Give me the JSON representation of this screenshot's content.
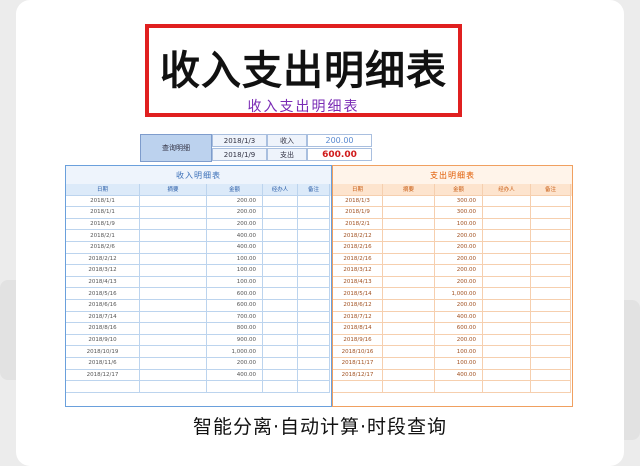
{
  "header": {
    "big_title": "收入支出明细表",
    "sub_title": "收入支出明细表"
  },
  "query": {
    "label": "查询明细",
    "date_start": "2018/1/3",
    "date_end": "2018/1/9",
    "income_label": "收入",
    "income_value": "200.00",
    "expense_label": "支出",
    "expense_value": "600.00"
  },
  "income_table": {
    "title": "收入明细表",
    "headers": [
      "日期",
      "摘要",
      "金额",
      "经办人",
      "备注"
    ],
    "rows": [
      [
        "2018/1/1",
        "",
        "200.00",
        "",
        ""
      ],
      [
        "2018/1/1",
        "",
        "200.00",
        "",
        ""
      ],
      [
        "2018/1/9",
        "",
        "200.00",
        "",
        ""
      ],
      [
        "2018/2/1",
        "",
        "400.00",
        "",
        ""
      ],
      [
        "2018/2/6",
        "",
        "400.00",
        "",
        ""
      ],
      [
        "2018/2/12",
        "",
        "100.00",
        "",
        ""
      ],
      [
        "2018/3/12",
        "",
        "100.00",
        "",
        ""
      ],
      [
        "2018/4/13",
        "",
        "100.00",
        "",
        ""
      ],
      [
        "2018/5/16",
        "",
        "600.00",
        "",
        ""
      ],
      [
        "2018/6/16",
        "",
        "600.00",
        "",
        ""
      ],
      [
        "2018/7/14",
        "",
        "700.00",
        "",
        ""
      ],
      [
        "2018/8/16",
        "",
        "800.00",
        "",
        ""
      ],
      [
        "2018/9/10",
        "",
        "900.00",
        "",
        ""
      ],
      [
        "2018/10/19",
        "",
        "1,000.00",
        "",
        ""
      ],
      [
        "2018/11/6",
        "",
        "200.00",
        "",
        ""
      ],
      [
        "2018/12/17",
        "",
        "400.00",
        "",
        ""
      ],
      [
        "",
        "",
        "",
        "",
        ""
      ]
    ]
  },
  "expense_table": {
    "title": "支出明细表",
    "headers": [
      "日期",
      "摘要",
      "金额",
      "经办人",
      "备注"
    ],
    "rows": [
      [
        "2018/1/3",
        "",
        "300.00",
        "",
        ""
      ],
      [
        "2018/1/9",
        "",
        "300.00",
        "",
        ""
      ],
      [
        "2018/2/1",
        "",
        "100.00",
        "",
        ""
      ],
      [
        "2018/2/12",
        "",
        "200.00",
        "",
        ""
      ],
      [
        "2018/2/16",
        "",
        "200.00",
        "",
        ""
      ],
      [
        "2018/2/16",
        "",
        "200.00",
        "",
        ""
      ],
      [
        "2018/3/12",
        "",
        "200.00",
        "",
        ""
      ],
      [
        "2018/4/13",
        "",
        "200.00",
        "",
        ""
      ],
      [
        "2018/5/14",
        "",
        "1,000.00",
        "",
        ""
      ],
      [
        "2018/6/12",
        "",
        "200.00",
        "",
        ""
      ],
      [
        "2018/7/12",
        "",
        "400.00",
        "",
        ""
      ],
      [
        "2018/8/14",
        "",
        "600.00",
        "",
        ""
      ],
      [
        "2018/9/16",
        "",
        "200.00",
        "",
        ""
      ],
      [
        "2018/10/16",
        "",
        "100.00",
        "",
        ""
      ],
      [
        "2018/11/17",
        "",
        "100.00",
        "",
        ""
      ],
      [
        "2018/12/17",
        "",
        "400.00",
        "",
        ""
      ],
      [
        "",
        "",
        "",
        "",
        ""
      ]
    ]
  },
  "footer": {
    "slogan": "智能分离·自动计算·时段查询"
  }
}
